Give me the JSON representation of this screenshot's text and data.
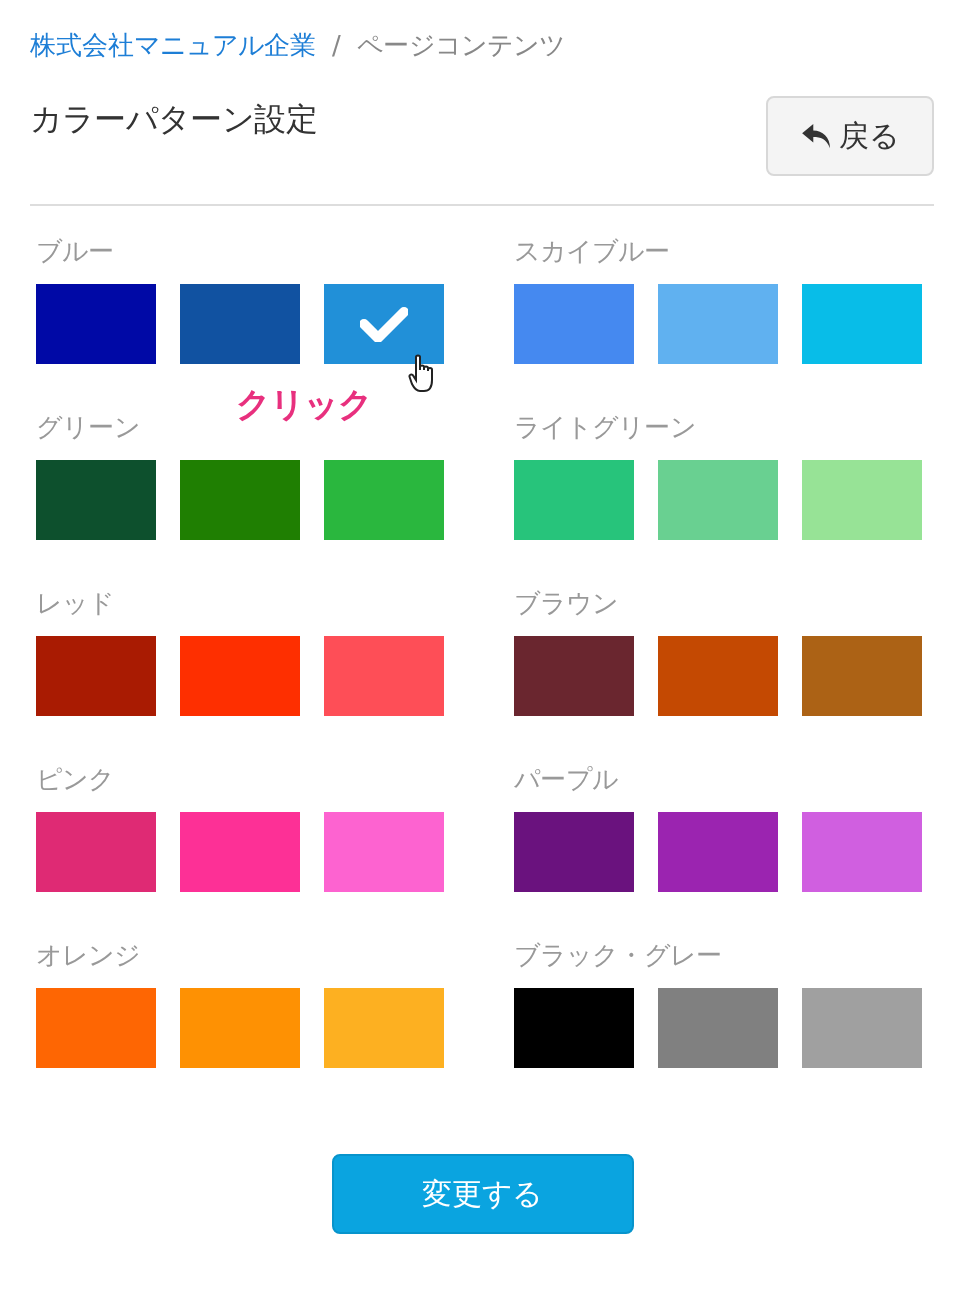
{
  "breadcrumb": [
    {
      "label": "株式会社マニュアル企業",
      "kind": "link"
    },
    {
      "label": "ページコンテンツ",
      "kind": "current"
    }
  ],
  "breadcrumb_separator": "/",
  "title": "カラーパターン設定",
  "back_button": "戻る",
  "groups": [
    {
      "label": "ブルー",
      "swatches": [
        {
          "color": "#0009a6",
          "selected": false
        },
        {
          "color": "#1152a1",
          "selected": false
        },
        {
          "color": "#2190d8",
          "selected": true,
          "callout": "クリック"
        }
      ]
    },
    {
      "label": "スカイブルー",
      "swatches": [
        {
          "color": "#4589f0",
          "selected": false
        },
        {
          "color": "#60b1f0",
          "selected": false
        },
        {
          "color": "#08bde8",
          "selected": false
        }
      ]
    },
    {
      "label": "グリーン",
      "swatches": [
        {
          "color": "#0d502d",
          "selected": false
        },
        {
          "color": "#1f7f02",
          "selected": false
        },
        {
          "color": "#2ab73e",
          "selected": false
        }
      ]
    },
    {
      "label": "ライトグリーン",
      "swatches": [
        {
          "color": "#27c47b",
          "selected": false
        },
        {
          "color": "#69d091",
          "selected": false
        },
        {
          "color": "#97e396",
          "selected": false
        }
      ]
    },
    {
      "label": "レッド",
      "swatches": [
        {
          "color": "#a91b02",
          "selected": false
        },
        {
          "color": "#fe2f00",
          "selected": false
        },
        {
          "color": "#fe4e57",
          "selected": false
        }
      ]
    },
    {
      "label": "ブラウン",
      "swatches": [
        {
          "color": "#6a262f",
          "selected": false
        },
        {
          "color": "#c44902",
          "selected": false
        },
        {
          "color": "#ac6215",
          "selected": false
        }
      ]
    },
    {
      "label": "ピンク",
      "swatches": [
        {
          "color": "#df2a74",
          "selected": false
        },
        {
          "color": "#fd3096",
          "selected": false
        },
        {
          "color": "#fd63d0",
          "selected": false
        }
      ]
    },
    {
      "label": "パープル",
      "swatches": [
        {
          "color": "#6a127e",
          "selected": false
        },
        {
          "color": "#9b24b0",
          "selected": false
        },
        {
          "color": "#d05fe0",
          "selected": false
        }
      ]
    },
    {
      "label": "オレンジ",
      "swatches": [
        {
          "color": "#fe6603",
          "selected": false
        },
        {
          "color": "#fe9103",
          "selected": false
        },
        {
          "color": "#fdb021",
          "selected": false
        }
      ]
    },
    {
      "label": "ブラック・グレー",
      "swatches": [
        {
          "color": "#000000",
          "selected": false
        },
        {
          "color": "#808080",
          "selected": false
        },
        {
          "color": "#a0a0a0",
          "selected": false
        }
      ]
    }
  ],
  "submit_button": "変更する"
}
